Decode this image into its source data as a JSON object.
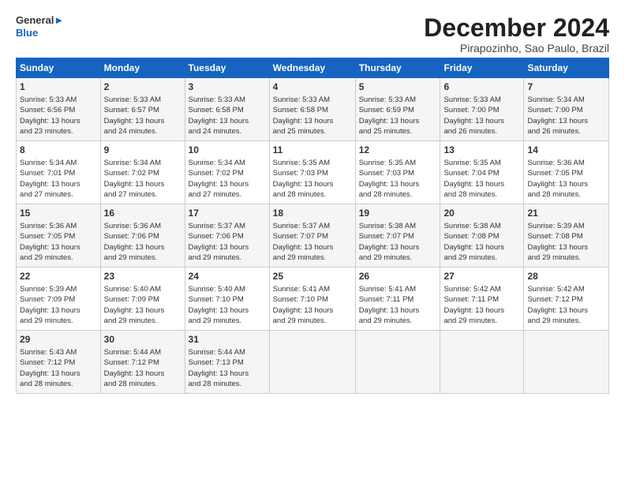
{
  "header": {
    "logo_line1": "General",
    "logo_line2": "Blue",
    "title": "December 2024",
    "subtitle": "Pirapozinho, Sao Paulo, Brazil"
  },
  "days_of_week": [
    "Sunday",
    "Monday",
    "Tuesday",
    "Wednesday",
    "Thursday",
    "Friday",
    "Saturday"
  ],
  "weeks": [
    [
      {
        "day": "1",
        "lines": [
          "Sunrise: 5:33 AM",
          "Sunset: 6:56 PM",
          "Daylight: 13 hours",
          "and 23 minutes."
        ]
      },
      {
        "day": "2",
        "lines": [
          "Sunrise: 5:33 AM",
          "Sunset: 6:57 PM",
          "Daylight: 13 hours",
          "and 24 minutes."
        ]
      },
      {
        "day": "3",
        "lines": [
          "Sunrise: 5:33 AM",
          "Sunset: 6:58 PM",
          "Daylight: 13 hours",
          "and 24 minutes."
        ]
      },
      {
        "day": "4",
        "lines": [
          "Sunrise: 5:33 AM",
          "Sunset: 6:58 PM",
          "Daylight: 13 hours",
          "and 25 minutes."
        ]
      },
      {
        "day": "5",
        "lines": [
          "Sunrise: 5:33 AM",
          "Sunset: 6:59 PM",
          "Daylight: 13 hours",
          "and 25 minutes."
        ]
      },
      {
        "day": "6",
        "lines": [
          "Sunrise: 5:33 AM",
          "Sunset: 7:00 PM",
          "Daylight: 13 hours",
          "and 26 minutes."
        ]
      },
      {
        "day": "7",
        "lines": [
          "Sunrise: 5:34 AM",
          "Sunset: 7:00 PM",
          "Daylight: 13 hours",
          "and 26 minutes."
        ]
      }
    ],
    [
      {
        "day": "8",
        "lines": [
          "Sunrise: 5:34 AM",
          "Sunset: 7:01 PM",
          "Daylight: 13 hours",
          "and 27 minutes."
        ]
      },
      {
        "day": "9",
        "lines": [
          "Sunrise: 5:34 AM",
          "Sunset: 7:02 PM",
          "Daylight: 13 hours",
          "and 27 minutes."
        ]
      },
      {
        "day": "10",
        "lines": [
          "Sunrise: 5:34 AM",
          "Sunset: 7:02 PM",
          "Daylight: 13 hours",
          "and 27 minutes."
        ]
      },
      {
        "day": "11",
        "lines": [
          "Sunrise: 5:35 AM",
          "Sunset: 7:03 PM",
          "Daylight: 13 hours",
          "and 28 minutes."
        ]
      },
      {
        "day": "12",
        "lines": [
          "Sunrise: 5:35 AM",
          "Sunset: 7:03 PM",
          "Daylight: 13 hours",
          "and 28 minutes."
        ]
      },
      {
        "day": "13",
        "lines": [
          "Sunrise: 5:35 AM",
          "Sunset: 7:04 PM",
          "Daylight: 13 hours",
          "and 28 minutes."
        ]
      },
      {
        "day": "14",
        "lines": [
          "Sunrise: 5:36 AM",
          "Sunset: 7:05 PM",
          "Daylight: 13 hours",
          "and 28 minutes."
        ]
      }
    ],
    [
      {
        "day": "15",
        "lines": [
          "Sunrise: 5:36 AM",
          "Sunset: 7:05 PM",
          "Daylight: 13 hours",
          "and 29 minutes."
        ]
      },
      {
        "day": "16",
        "lines": [
          "Sunrise: 5:36 AM",
          "Sunset: 7:06 PM",
          "Daylight: 13 hours",
          "and 29 minutes."
        ]
      },
      {
        "day": "17",
        "lines": [
          "Sunrise: 5:37 AM",
          "Sunset: 7:06 PM",
          "Daylight: 13 hours",
          "and 29 minutes."
        ]
      },
      {
        "day": "18",
        "lines": [
          "Sunrise: 5:37 AM",
          "Sunset: 7:07 PM",
          "Daylight: 13 hours",
          "and 29 minutes."
        ]
      },
      {
        "day": "19",
        "lines": [
          "Sunrise: 5:38 AM",
          "Sunset: 7:07 PM",
          "Daylight: 13 hours",
          "and 29 minutes."
        ]
      },
      {
        "day": "20",
        "lines": [
          "Sunrise: 5:38 AM",
          "Sunset: 7:08 PM",
          "Daylight: 13 hours",
          "and 29 minutes."
        ]
      },
      {
        "day": "21",
        "lines": [
          "Sunrise: 5:39 AM",
          "Sunset: 7:08 PM",
          "Daylight: 13 hours",
          "and 29 minutes."
        ]
      }
    ],
    [
      {
        "day": "22",
        "lines": [
          "Sunrise: 5:39 AM",
          "Sunset: 7:09 PM",
          "Daylight: 13 hours",
          "and 29 minutes."
        ]
      },
      {
        "day": "23",
        "lines": [
          "Sunrise: 5:40 AM",
          "Sunset: 7:09 PM",
          "Daylight: 13 hours",
          "and 29 minutes."
        ]
      },
      {
        "day": "24",
        "lines": [
          "Sunrise: 5:40 AM",
          "Sunset: 7:10 PM",
          "Daylight: 13 hours",
          "and 29 minutes."
        ]
      },
      {
        "day": "25",
        "lines": [
          "Sunrise: 5:41 AM",
          "Sunset: 7:10 PM",
          "Daylight: 13 hours",
          "and 29 minutes."
        ]
      },
      {
        "day": "26",
        "lines": [
          "Sunrise: 5:41 AM",
          "Sunset: 7:11 PM",
          "Daylight: 13 hours",
          "and 29 minutes."
        ]
      },
      {
        "day": "27",
        "lines": [
          "Sunrise: 5:42 AM",
          "Sunset: 7:11 PM",
          "Daylight: 13 hours",
          "and 29 minutes."
        ]
      },
      {
        "day": "28",
        "lines": [
          "Sunrise: 5:42 AM",
          "Sunset: 7:12 PM",
          "Daylight: 13 hours",
          "and 29 minutes."
        ]
      }
    ],
    [
      {
        "day": "29",
        "lines": [
          "Sunrise: 5:43 AM",
          "Sunset: 7:12 PM",
          "Daylight: 13 hours",
          "and 28 minutes."
        ]
      },
      {
        "day": "30",
        "lines": [
          "Sunrise: 5:44 AM",
          "Sunset: 7:12 PM",
          "Daylight: 13 hours",
          "and 28 minutes."
        ]
      },
      {
        "day": "31",
        "lines": [
          "Sunrise: 5:44 AM",
          "Sunset: 7:13 PM",
          "Daylight: 13 hours",
          "and 28 minutes."
        ]
      },
      null,
      null,
      null,
      null
    ]
  ]
}
